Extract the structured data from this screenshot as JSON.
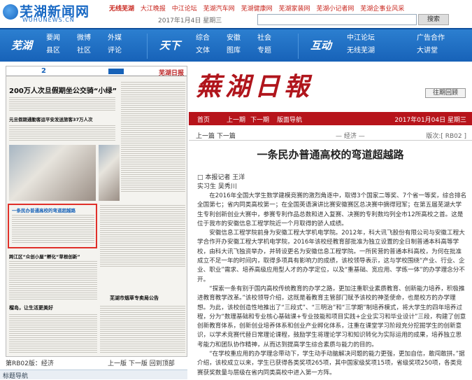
{
  "site": {
    "logo_cn": "芜湖新闻网",
    "logo_en": "WUHUNEWS.CN",
    "date": "2017年1月4日 星期三",
    "search_button": "搜索",
    "top_links": [
      "无线芜湖",
      "大江晚报",
      "中江论坛",
      "芜湖汽车网",
      "芜湖健康网",
      "芜湖家装网",
      "芜湖小记者网",
      "芜湖企事业风采"
    ]
  },
  "nav": {
    "block1": {
      "title": "芜湖",
      "items": [
        [
          "要闻",
          "县区"
        ],
        [
          "微博",
          "社区"
        ],
        [
          "外媒",
          "评论"
        ]
      ]
    },
    "block2": {
      "title": "天下",
      "items": [
        [
          "综合",
          "文体"
        ],
        [
          "安徽",
          "图库"
        ],
        [
          "社会",
          "专题"
        ]
      ]
    },
    "block3": {
      "title": "互动",
      "items": [
        [
          "中江论坛",
          "无线芜湖"
        ],
        [
          "广告合作",
          "大讲堂"
        ]
      ]
    }
  },
  "paper": {
    "page_no": "2",
    "paper_name": "芜湖日报",
    "headline1": "200万人次旦假期坐公交骑“小绿”",
    "headline2": "元旦假期通勤客运平安发送旅客37万人次",
    "headline3": "一条民办普通高校的弯道超越路",
    "headline4": "跨江区“众创小屋”孵化“草根创新”",
    "headline5": "榴岛，让生活更美好",
    "headline6": "芜湖市烟草专卖局公告",
    "headline7": "“建康包”送上门",
    "footer_page": "第RB02版：经济",
    "prev": "上一版",
    "next": "下一版",
    "back_top": "回到顶部"
  },
  "masthead": {
    "brand": "蕪湖日報",
    "back_issues": "往期回顾"
  },
  "redbar": {
    "home": "首页",
    "prev_issue": "上一期",
    "next_issue": "下一期",
    "nav": "版面导航",
    "date": "2017年01月04日 星期三"
  },
  "subbar": {
    "prev_article": "上一篇",
    "next_article": "下一篇",
    "section": "— 经济 —",
    "edition": "版次:[ RB02 ]"
  },
  "article": {
    "title": "一条民办普通高校的弯道超越路",
    "byline1": "□ 本报记者 王洋",
    "byline2": "实习生 吴秀川",
    "p1": "在2016年全国大学生数学建模竞赛的激烈角逐中，取得3个国家二等奖、7个省一等奖，综合排名全国第七；省内同类高校第一；在全国英语演讲比赛安徽赛区总决赛中摘得冠军；在第五届芜湖大学生专利创新创业大赛中，参赛专利作品总数和进入复赛、决赛的专利数均列全市12所高校之首。这是位于我市的安徽信息工程学院近一个月取得的骄人成绩。",
    "p2": "安徽信息工程学院前身为安徽工程大学机电学院。2012年，科大讯飞股份有限公司与安徽工程大学合作开办安徽工程大学机电学院，2016年该校经教育部批准为独立设置的全日制普通本科高等学校，由科大讯飞独资举办，并转设更名为安徽信息工程学院。一所民营的普通本科高校，为何在批准成立不足一年的时间内，取得多项具有影响力的成绩，该校领导表示，这与学校围绕“产业、行业、企业、职业”需求、培养高级应用型人才的办学定位，以及“重基础、宽应用、学练一体”的办学理念分不开。",
    "p3": "“探索一条有别于国内高校传统教育的办学之路，更加注重职业素质教育、创新能力培养，积极推进教育教学改革。”该校领导介绍，这既是着教育主管部门赋予该校的神圣使命，也是校方的办学理想。为此，该校创造性地推出了“三段式”、“三明治”和“三学期”制培养模式，将大学生的四年培养过程，分为“数理基础和专业核心基础课+专业技能和项目实践+企业实习和毕业设计”三段，构建了创意创新教育体系，创新创业培养体系和创业产业孵化体系，注重在课堂学习阶段充分挖掘学生的创新意识，以学术竞赛代替日常理论课程，鼓励学生将理论学习和知识转化为实际运用的成果，培养独立思考能力和团队协作精神，从而达到提高学生综合素质与能力的目的。",
    "p4": "“在学校重应用的办学理念带动下，学生动手动脑解决问题的能力更强，更加自信，敢闯敢拼。”据介绍，该校成立以来，学生已获得各类奖项265项，其中国家级奖项15项，省级奖项250项，各类竞赛获奖数量与层级在省内同类高校中进入第一方阵。"
  },
  "guide": {
    "title": "标题导航",
    "item1": "“建康包”送上门"
  },
  "colors": {
    "brand_blue": "#1762b8",
    "brand_red": "#b7141b"
  }
}
